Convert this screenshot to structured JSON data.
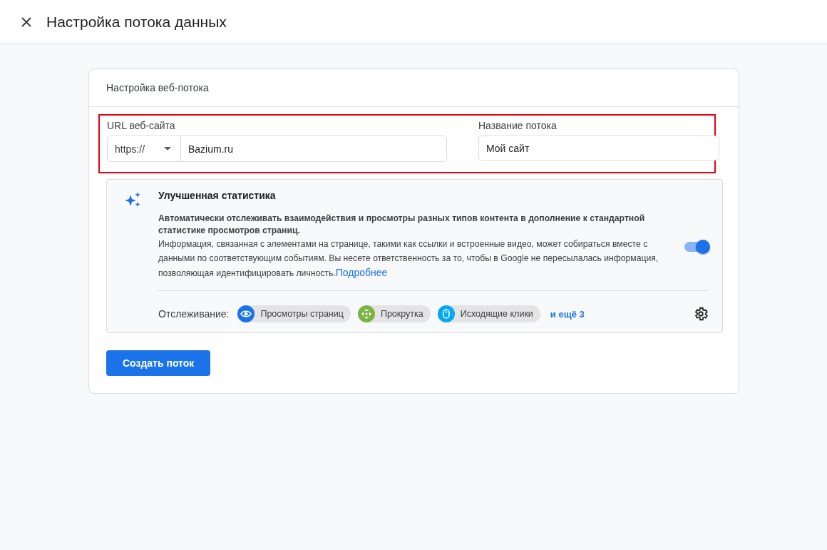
{
  "window": {
    "title": "Настройка потока данных"
  },
  "card": {
    "title": "Настройка веб-потока",
    "fields": {
      "highlighted": true,
      "url": {
        "label": "URL веб-сайта",
        "protocol": "https://",
        "value": "Bazium.ru"
      },
      "name": {
        "label": "Название потока",
        "value": "Мой сайт"
      }
    },
    "enhanced": {
      "title": "Улучшенная статистика",
      "summary": "Автоматически отслеживать взаимодействия и просмотры разных типов контента в дополнение к стандартной статистике просмотров страниц.",
      "info": "Информация, связанная с элементами на странице, такими как ссылки и встроенные видео, может собираться вместе с данными по соответствующим событиям. Вы несете ответственность за то, чтобы в Google не пересылалась информация, позволяющая идентифицировать личность.",
      "link": "Подробнее",
      "on": true,
      "tracking_label": "Отслеживание:",
      "chips": [
        {
          "kind": "eye",
          "label": "Просмотры страниц",
          "color": "#1a73e8"
        },
        {
          "kind": "scroll",
          "label": "Прокрутка",
          "color": "#7cb342"
        },
        {
          "kind": "mouse",
          "label": "Исходящие клики",
          "color": "#03a9f4"
        }
      ],
      "more": "и ещё 3"
    },
    "button": "Создать поток"
  }
}
